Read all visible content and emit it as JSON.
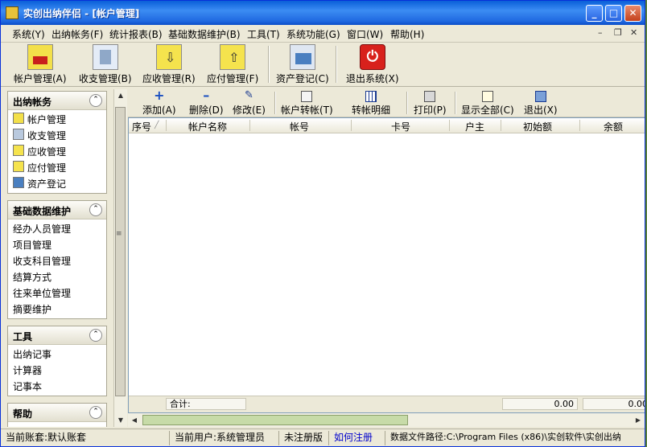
{
  "window": {
    "title": "实创出纳伴侣 - [帐户管理]"
  },
  "menu": [
    "系统(Y)",
    "出纳帐务(F)",
    "统计报表(B)",
    "基础数据维护(B)",
    "工具(T)",
    "系统功能(G)",
    "窗口(W)",
    "帮助(H)"
  ],
  "toolbar": {
    "buttons": [
      "帐户管理(A)",
      "收支管理(B)",
      "应收管理(R)",
      "应付管理(F)",
      "资产登记(C)",
      "退出系统(X)"
    ]
  },
  "groups": [
    {
      "title": "出纳帐务",
      "items": [
        "帐户管理",
        "收支管理",
        "应收管理",
        "应付管理",
        "资产登记"
      ]
    },
    {
      "title": "基础数据维护",
      "items": [
        "经办人员管理",
        "项目管理",
        "收支科目管理",
        "结算方式",
        "往来单位管理",
        "摘要维护"
      ]
    },
    {
      "title": "工具",
      "items": [
        "出纳记事",
        "计算器",
        "记事本"
      ]
    },
    {
      "title": "帮助",
      "items": []
    }
  ],
  "subtoolbar": {
    "buttons": [
      "添加(A)",
      "删除(D)",
      "修改(E)",
      "帐户转帐(T)",
      "转帐明细",
      "打印(P)",
      "显示全部(C)",
      "退出(X)"
    ]
  },
  "table": {
    "columns": [
      "序号",
      "帐户名称",
      "帐号",
      "卡号",
      "户主",
      "初始额",
      "余额"
    ],
    "footer": {
      "label": "合计:",
      "initial_total": "0.00",
      "balance_total": "0.00"
    }
  },
  "statusbar": {
    "account_set": "当前账套:默认账套",
    "user": "当前用户:系统管理员",
    "registration": "未注册版",
    "register_link": "如何注册",
    "data_path": "数据文件路径:C:\\Program Files (x86)\\实创软件\\实创出纳"
  },
  "colors": {
    "titlebar": "#0a5fd8",
    "link": "#0000cc"
  }
}
